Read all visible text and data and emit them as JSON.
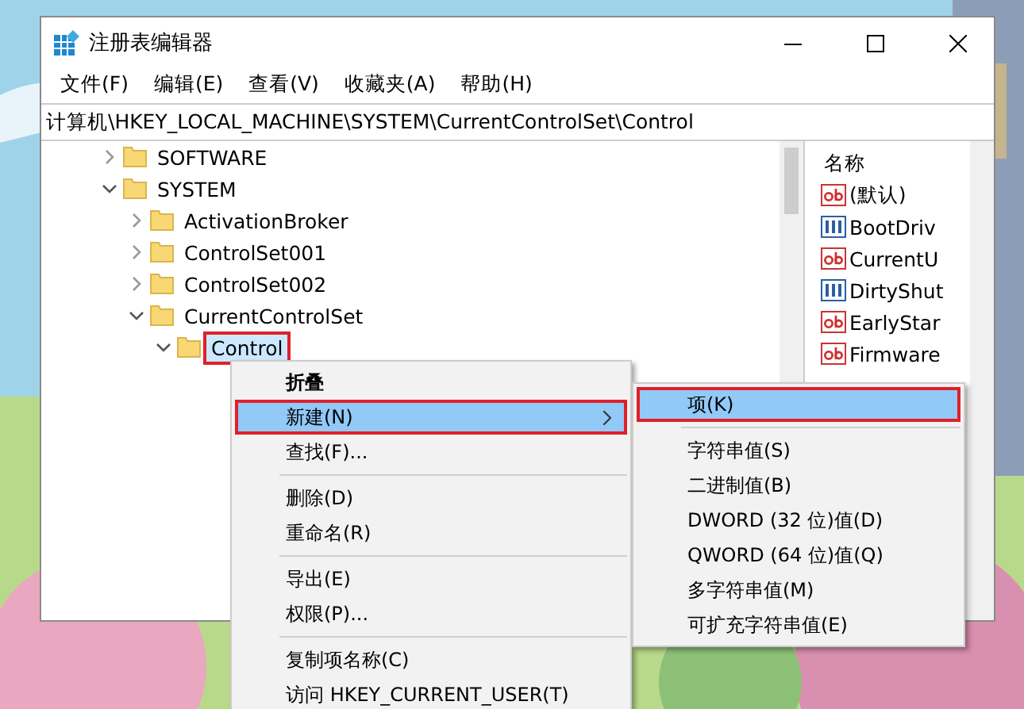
{
  "window": {
    "title": "注册表编辑器"
  },
  "menu": [
    "文件(F)",
    "编辑(E)",
    "查看(V)",
    "收藏夹(A)",
    "帮助(H)"
  ],
  "address": {
    "value": "计算机\\HKEY_LOCAL_MACHINE\\SYSTEM\\CurrentControlSet\\Control"
  },
  "tree": [
    {
      "label": "SOFTWARE",
      "expanded": false,
      "selected": false,
      "annotated": false
    },
    {
      "label": "SYSTEM",
      "expanded": true,
      "selected": false,
      "annotated": false,
      "children": [
        {
          "label": "ActivationBroker",
          "expanded": false,
          "selected": false,
          "annotated": false
        },
        {
          "label": "ControlSet001",
          "expanded": false,
          "selected": false,
          "annotated": false
        },
        {
          "label": "ControlSet002",
          "expanded": false,
          "selected": false,
          "annotated": false
        },
        {
          "label": "CurrentControlSet",
          "expanded": true,
          "selected": false,
          "annotated": false,
          "children": [
            {
              "label": "Control",
              "expanded": true,
              "selected": true,
              "annotated": true
            }
          ]
        }
      ]
    }
  ],
  "values": {
    "header": "名称",
    "items": [
      {
        "kind": "string",
        "name": "(默认)"
      },
      {
        "kind": "binary",
        "name": "BootDriv"
      },
      {
        "kind": "string",
        "name": "CurrentU"
      },
      {
        "kind": "binary",
        "name": "DirtyShut"
      },
      {
        "kind": "string",
        "name": "EarlyStar"
      },
      {
        "kind": "string",
        "name": "Firmware"
      }
    ]
  },
  "context_menu": [
    {
      "kind": "item",
      "label": "折叠",
      "bold": true,
      "selected": false,
      "annotated": false,
      "submenu": false
    },
    {
      "kind": "item",
      "label": "新建(N)",
      "bold": false,
      "selected": true,
      "annotated": true,
      "submenu": true
    },
    {
      "kind": "item",
      "label": "查找(F)...",
      "bold": false,
      "selected": false,
      "annotated": false,
      "submenu": false
    },
    {
      "kind": "separator"
    },
    {
      "kind": "item",
      "label": "删除(D)",
      "bold": false,
      "selected": false,
      "annotated": false,
      "submenu": false
    },
    {
      "kind": "item",
      "label": "重命名(R)",
      "bold": false,
      "selected": false,
      "annotated": false,
      "submenu": false
    },
    {
      "kind": "separator"
    },
    {
      "kind": "item",
      "label": "导出(E)",
      "bold": false,
      "selected": false,
      "annotated": false,
      "submenu": false
    },
    {
      "kind": "item",
      "label": "权限(P)...",
      "bold": false,
      "selected": false,
      "annotated": false,
      "submenu": false
    },
    {
      "kind": "separator"
    },
    {
      "kind": "item",
      "label": "复制项名称(C)",
      "bold": false,
      "selected": false,
      "annotated": false,
      "submenu": false
    },
    {
      "kind": "item",
      "label": "访问 HKEY_CURRENT_USER(T)",
      "bold": false,
      "selected": false,
      "annotated": false,
      "submenu": false
    }
  ],
  "submenu": [
    {
      "kind": "item",
      "label": "项(K)",
      "selected": true,
      "annotated": true
    },
    {
      "kind": "separator"
    },
    {
      "kind": "item",
      "label": "字符串值(S)",
      "selected": false,
      "annotated": false
    },
    {
      "kind": "item",
      "label": "二进制值(B)",
      "selected": false,
      "annotated": false
    },
    {
      "kind": "item",
      "label": "DWORD (32 位)值(D)",
      "selected": false,
      "annotated": false
    },
    {
      "kind": "item",
      "label": "QWORD (64 位)值(Q)",
      "selected": false,
      "annotated": false
    },
    {
      "kind": "item",
      "label": "多字符串值(M)",
      "selected": false,
      "annotated": false
    },
    {
      "kind": "item",
      "label": "可扩充字符串值(E)",
      "selected": false,
      "annotated": false
    }
  ]
}
